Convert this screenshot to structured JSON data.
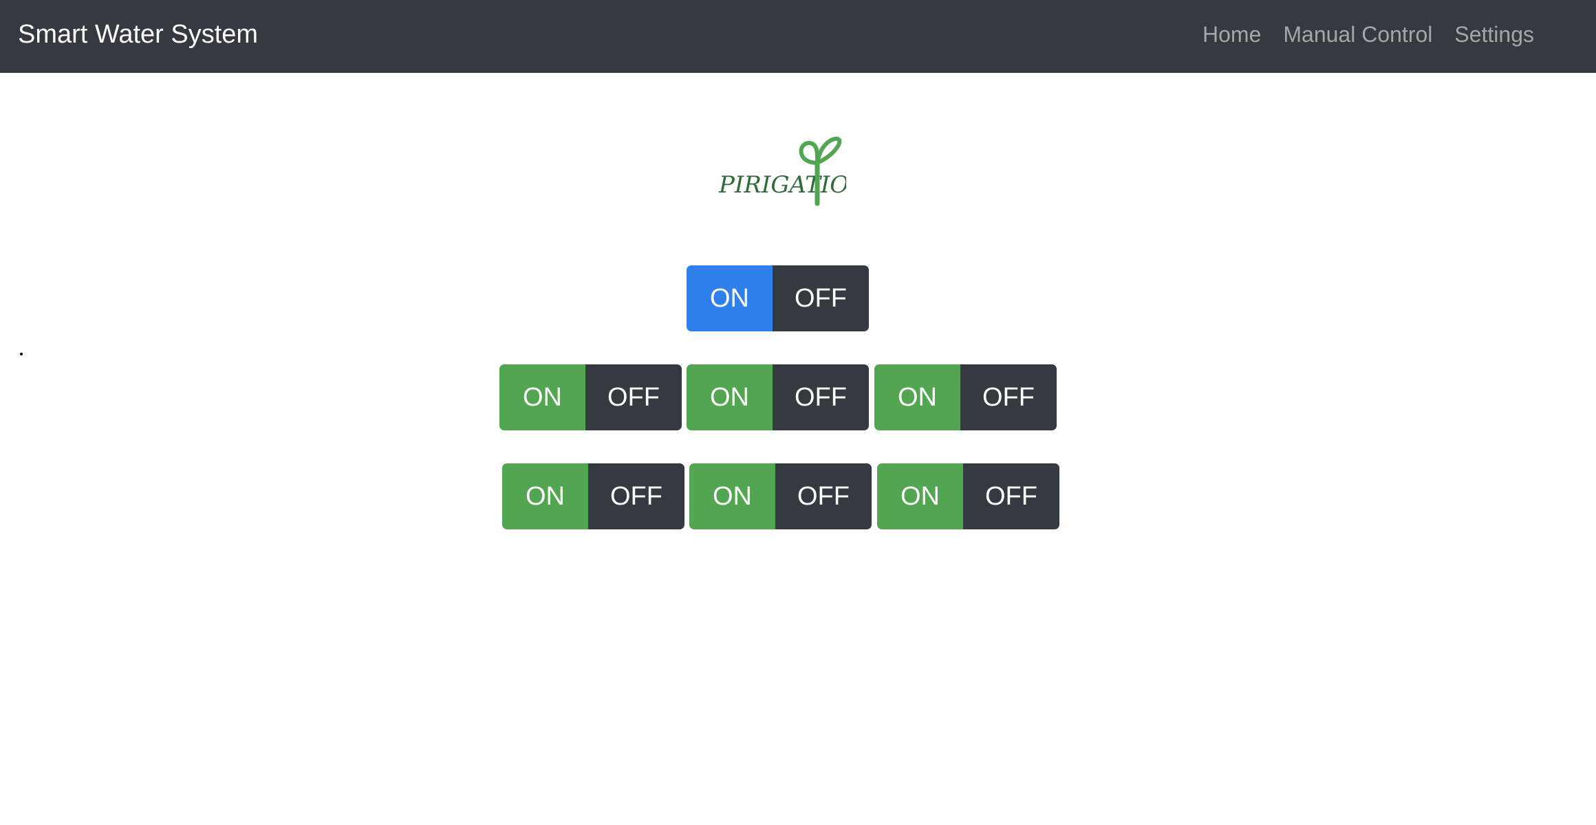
{
  "navbar": {
    "brand": "Smart Water System",
    "links": [
      "Home",
      "Manual Control",
      "Settings"
    ]
  },
  "logo": {
    "text": "PIRIGATION",
    "icon": "sprout-icon",
    "color": "#52a651"
  },
  "master_switch": {
    "on_label": "ON",
    "off_label": "OFF",
    "on_color": "#2f80ed"
  },
  "zone_switches": {
    "row1": [
      {
        "on_label": "ON",
        "off_label": "OFF"
      },
      {
        "on_label": "ON",
        "off_label": "OFF"
      },
      {
        "on_label": "ON",
        "off_label": "OFF"
      }
    ],
    "row2": [
      {
        "on_label": "ON",
        "off_label": "OFF"
      },
      {
        "on_label": "ON",
        "off_label": "OFF"
      },
      {
        "on_label": "ON",
        "off_label": "OFF"
      }
    ],
    "on_color": "#52a651",
    "off_color": "#343a40"
  }
}
